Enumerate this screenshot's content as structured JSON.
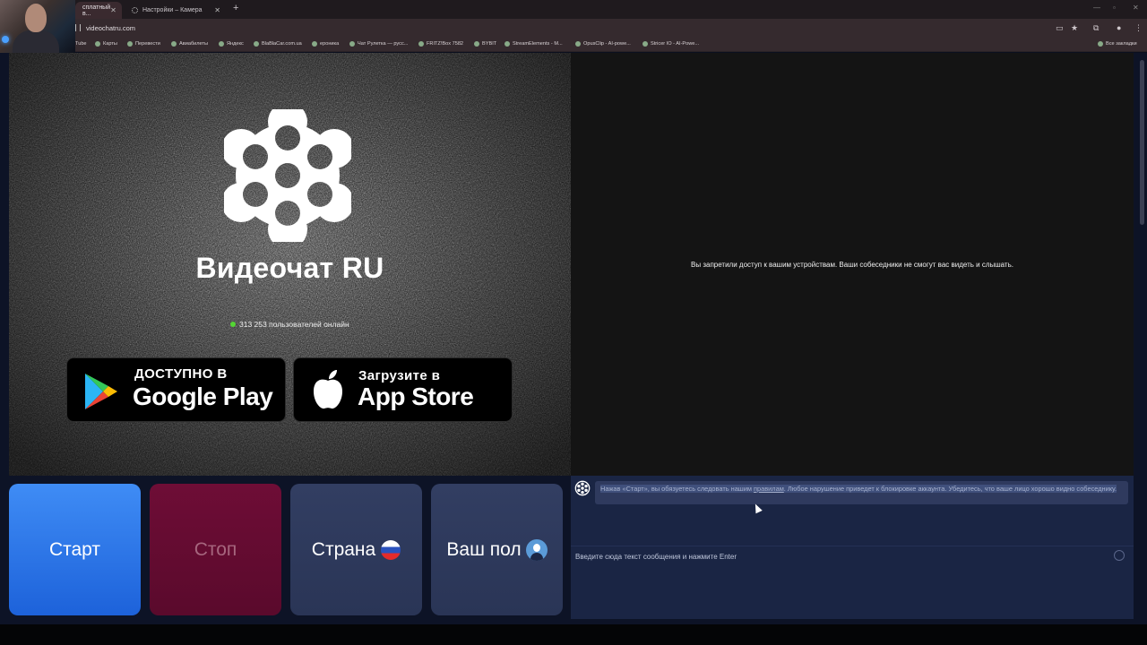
{
  "browser": {
    "tabs": [
      {
        "label": "сплатный в...",
        "active": true
      },
      {
        "label": "Настройки – Камера",
        "active": false
      }
    ],
    "new_tab": "+",
    "url": "videochatru.com",
    "bookmarks": [
      "Tube",
      "Карты",
      "Перевести",
      "Авиабилеты",
      "Яндекс",
      "BlaBlaCar.com.ua",
      "ероника",
      "Чат Рулетка — русс...",
      "FRITZ!Box 7582",
      "BYBIT",
      "StreamElements - M...",
      "OpusClip - AI-powe...",
      "Stricer IO - AI-Powe..."
    ],
    "all_bookmarks": "Все закладки"
  },
  "app": {
    "brand": "Видеочат RU",
    "online_text": "313 253 пользователей онлайн",
    "google_play": {
      "small": "ДОСТУПНО В",
      "big": "Google Play"
    },
    "app_store": {
      "small": "Загрузите в",
      "big": "App Store"
    },
    "camera_denied": "Вы запретили доступ к вашим устройствам. Ваши собеседники не смогут вас видеть и слышать.",
    "buttons": {
      "start": "Старт",
      "stop": "Стоп",
      "country": "Страна",
      "gender": "Ваш пол"
    },
    "chat": {
      "notice_prefix": "Нажав «Старт», вы обязуетесь следовать нашим ",
      "notice_link": "правилам",
      "notice_suffix": ". Любое нарушение приведет к блокировке аккаунта. Убедитесь, что ваше лицо хорошо видно собеседнику.",
      "input_placeholder": "Введите сюда текст сообщения и нажмите Enter"
    }
  },
  "colors": {
    "start": "#2f7be8",
    "stop": "#640c31",
    "panel": "#2f3a5e",
    "online_dot": "#54d634"
  },
  "icons": [
    "gear-icon",
    "close-icon",
    "apps-icon",
    "star-icon",
    "extensions-icon",
    "profile-icon",
    "menu-icon",
    "folder-icon",
    "revolver-logo-icon",
    "google-play-icon",
    "apple-icon",
    "russia-flag-icon",
    "gender-avatar-icon",
    "emoji-icon"
  ]
}
